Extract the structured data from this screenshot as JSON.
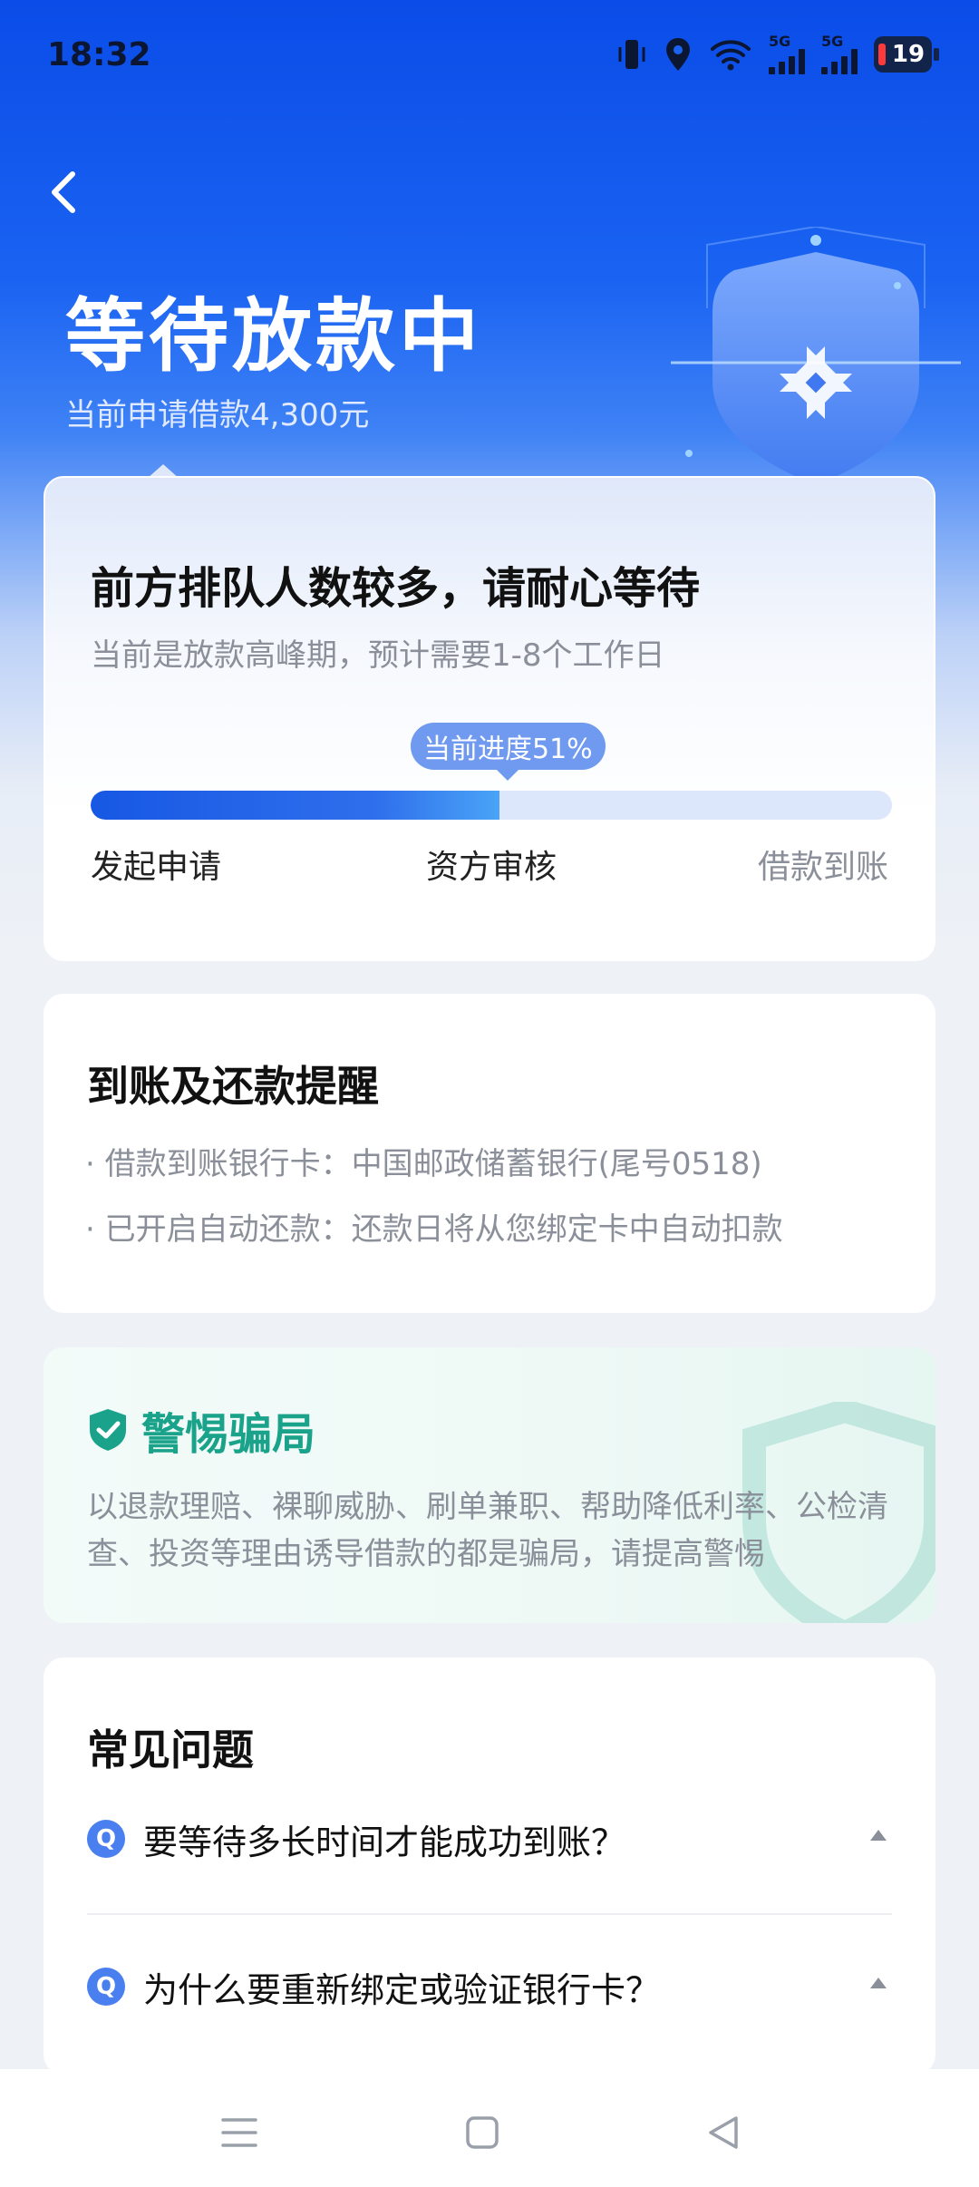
{
  "status_bar": {
    "time": "18:32",
    "battery": "19",
    "network_1": "5G",
    "network_2": "5G"
  },
  "header": {
    "title": "等待放款中",
    "subtitle": "当前申请借款4,300元"
  },
  "progress_card": {
    "title": "前方排队人数较多，请耐心等待",
    "subtitle": "当前是放款高峰期，预计需要1-8个工作日",
    "tip": "当前进度51%",
    "progress_percent": 51,
    "steps": [
      "发起申请",
      "资方审核",
      "借款到账"
    ]
  },
  "reminder_card": {
    "title": "到账及还款提醒",
    "lines": [
      "· 借款到账银行卡：中国邮政储蓄银行(尾号0518)",
      "· 已开启自动还款：还款日将从您绑定卡中自动扣款"
    ]
  },
  "warning_card": {
    "title": "警惕骗局",
    "text": "以退款理赔、裸聊威胁、刷单兼职、帮助降低利率、公检清查、投资等理由诱导借款的都是骗局，请提高警惕"
  },
  "faq_card": {
    "title": "常见问题",
    "badge": "Q",
    "items": [
      "要等待多长时间才能成功到账？",
      "为什么要重新绑定或验证银行卡？"
    ]
  },
  "colors": {
    "primary": "#1758e4",
    "warning": "#1aa38a",
    "muted": "#8a8f99"
  },
  "icons": [
    "back-arrow-icon",
    "shield-illustration-icon",
    "shield-check-icon",
    "chevron-up-icon",
    "menu-icon",
    "home-icon",
    "back-triangle-icon"
  ]
}
